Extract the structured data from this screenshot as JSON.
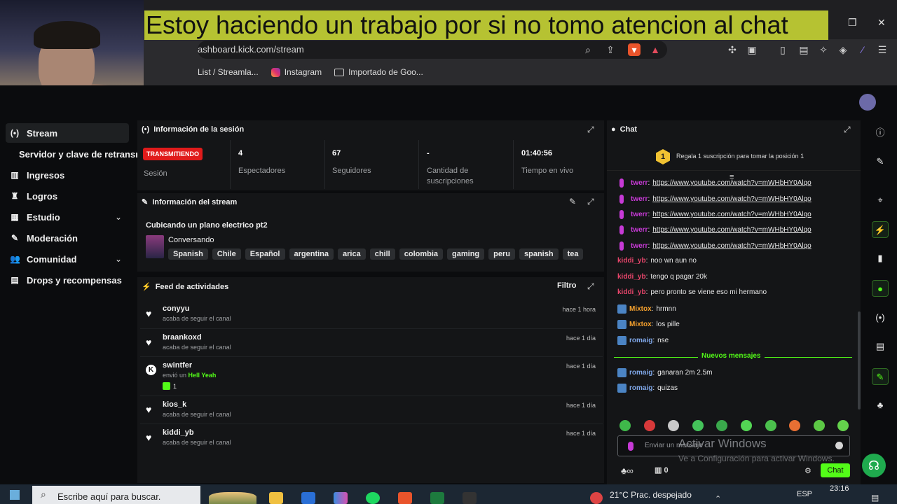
{
  "overlay": {
    "text": "Estoy haciendo un trabajo por si no tomo atencion al chat"
  },
  "browser": {
    "url": "ashboard.kick.com/stream",
    "bookmarks": [
      "List / Streamla...",
      "Instagram",
      "Importado de Goo..."
    ]
  },
  "sidebar": {
    "items": [
      {
        "label": "Stream",
        "icon": "broadcast-icon"
      },
      {
        "label": "Servidor y clave de retransm",
        "icon": ""
      },
      {
        "label": "Ingresos",
        "icon": "chart-icon"
      },
      {
        "label": "Logros",
        "icon": "trophy-icon"
      },
      {
        "label": "Estudio",
        "icon": "grid-icon"
      },
      {
        "label": "Moderación",
        "icon": "wrench-icon"
      },
      {
        "label": "Comunidad",
        "icon": "users-icon"
      },
      {
        "label": "Drops y recompensas",
        "icon": "gift-icon"
      }
    ]
  },
  "session": {
    "title": "Información de la sesión",
    "badge": "TRANSMITIENDO",
    "status_label": "Sesión",
    "stats": [
      {
        "value": "4",
        "label": "Espectadores"
      },
      {
        "value": "67",
        "label": "Seguidores"
      },
      {
        "value": "-",
        "label": "Cantidad de suscripciones"
      },
      {
        "value": "01:40:56",
        "label": "Tiempo en vivo"
      }
    ]
  },
  "stream_info": {
    "title": "Información del stream",
    "stream_title": "Cubicando un plano electrico pt2",
    "category": "Conversando",
    "tags": [
      "Spanish",
      "Chile",
      "Español",
      "argentina",
      "arica",
      "chill",
      "colombia",
      "gaming",
      "peru",
      "spanish",
      "tea"
    ]
  },
  "feed": {
    "title": "Feed de actividades",
    "filter_label": "Filtro",
    "items": [
      {
        "name": "conyyu",
        "sub": "acaba de seguir el canal",
        "time": "hace 1 hora"
      },
      {
        "name": "braankoxd",
        "sub": "acaba de seguir el canal",
        "time": "hace 1 día"
      },
      {
        "name": "swintfer",
        "sub": "envió un",
        "sub_highlight": "Hell Yeah",
        "count": "1",
        "time": "hace 1 día"
      },
      {
        "name": "kios_k",
        "sub": "acaba de seguir el canal",
        "time": "hace 1 día"
      },
      {
        "name": "kiddi_yb",
        "sub": "acaba de seguir el canal",
        "time": "hace 1 día"
      }
    ]
  },
  "chat": {
    "title": "Chat",
    "gift_prompt": "Regala 1 suscripción para tomar la posición 1",
    "gift_rank": "1",
    "new_messages_label": "Nuevos mensajes",
    "messages": [
      {
        "user": "twerr",
        "text": "https://www.youtube.com/watch?v=mWHbHY0Alqo",
        "color": "#c73ad6",
        "link": true
      },
      {
        "user": "twerr",
        "text": "https://www.youtube.com/watch?v=mWHbHY0Alqo",
        "color": "#c73ad6",
        "link": true
      },
      {
        "user": "twerr",
        "text": "https://www.youtube.com/watch?v=mWHbHY0Alqo",
        "color": "#c73ad6",
        "link": true
      },
      {
        "user": "twerr",
        "text": "https://www.youtube.com/watch?v=mWHbHY0Alqo",
        "color": "#c73ad6",
        "link": true
      },
      {
        "user": "twerr",
        "text": "https://www.youtube.com/watch?v=mWHbHY0Alqo",
        "color": "#c73ad6",
        "link": true
      },
      {
        "user": "kiddi_yb",
        "text": "noo wn aun no",
        "color": "#e8456b"
      },
      {
        "user": "kiddi_yb",
        "text": "tengo q pagar 20k",
        "color": "#e8456b"
      },
      {
        "user": "kiddi_yb",
        "text": "pero pronto se viene eso mi hermano",
        "color": "#e8456b"
      },
      {
        "user": "Mixtox",
        "text": "hrmnn",
        "color": "#f7a22e"
      },
      {
        "user": "Mixtox",
        "text": "los pille",
        "color": "#f7a22e"
      },
      {
        "user": "romaig",
        "text": "nse",
        "color": "#7fa7e8"
      },
      {
        "user": "romaig",
        "text": "ganaran 2m 2.5m",
        "color": "#7fa7e8"
      },
      {
        "user": "romaig",
        "text": "quizas",
        "color": "#7fa7e8"
      }
    ],
    "input_placeholder": "Enviar un mensaje",
    "send_label": "Chat",
    "points": "0"
  },
  "watermark": {
    "line1": "Activar Windows",
    "line2": "Ve a Configuración para activar Windows."
  },
  "taskbar": {
    "search_placeholder": "Escribe aquí para buscar.",
    "weather": "21°C  Prac. despejado",
    "lang": "ESP",
    "time": "23:16"
  },
  "colors": {
    "kick_green": "#53fc18",
    "live_red": "#e01b1b",
    "overlay_bg": "#b6c232"
  }
}
